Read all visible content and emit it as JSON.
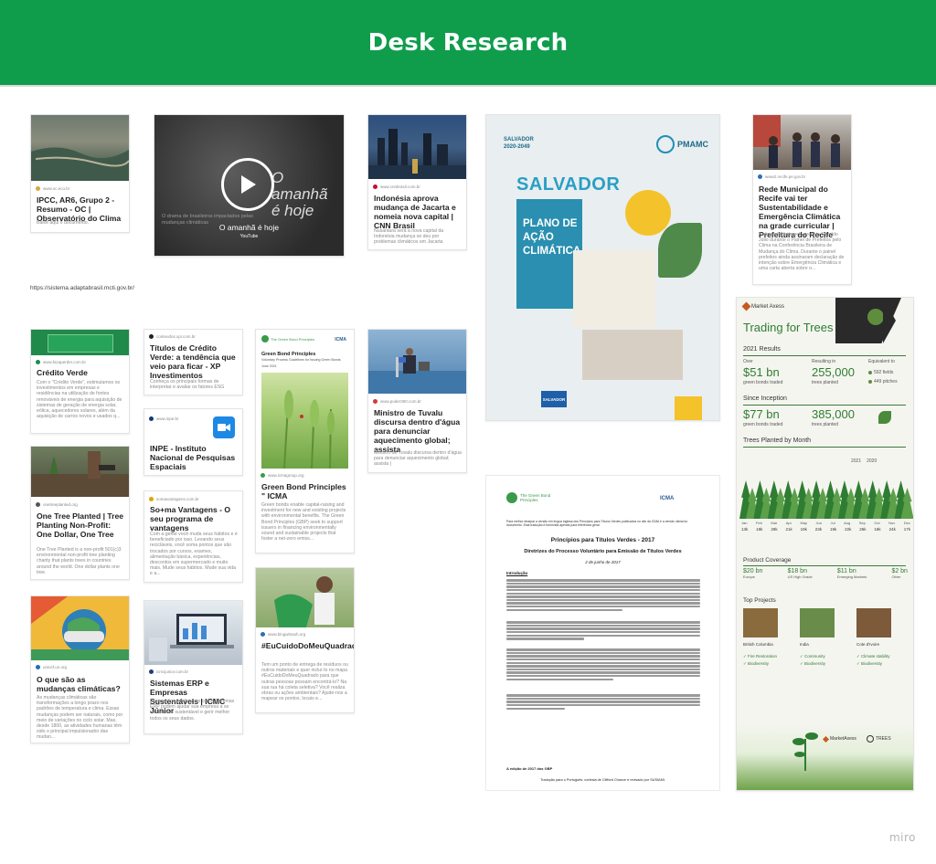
{
  "header": {
    "title": "Desk Research"
  },
  "footer": {
    "brand": "miro",
    "url_text": "https://sistema.adaptabrasil.mcti.gov.br/"
  },
  "cards": {
    "ipcc": {
      "source": "www.oc.eco.br",
      "title": "IPCC, AR6, Grupo 2 - Resumo - OC | Observatório do Clima",
      "desc": "Baixe aqui o documento."
    },
    "video": {
      "overlay": "O amanhã é hoje",
      "caption": "O amanhã é hoje",
      "platform": "YouTube",
      "subtitle": "O drama de brasileiros impactados pelas mudanças climáticas"
    },
    "indonesia": {
      "source": "www.cnnbrasil.com.br",
      "title": "Indonésia aprova mudança de Jacarta e nomeia nova capital | CNN Brasil",
      "desc": "Nusantara será a nova capital da Indonésia mudança se deu por problemas climáticos em Jacarta"
    },
    "salvador": {
      "top": "SALVADOR",
      "years": "2020-2049",
      "city": "SALVADOR",
      "plan": "PLANO DE AÇÃO CLIMÁTICA",
      "logo": "PMAMC",
      "bottom": "SALVADOR"
    },
    "recife": {
      "source": "www2.recife.pe.gov.br",
      "title": "Rede Municipal do Recife vai ter Sustentabilidade e Emergência Climática na grade curricular | Prefeitura do Recife",
      "desc": "Anúncio foi feito pelo prefeito Geraldo Júlio durante o Painel de Prefeitos pelo Clima na Conferência Brasileira de Mudança do Clima. Durante o painel prefeitos ainda assinaram declaração de intenção sobre Emergência Climática e uma carta aberta sobre o..."
    },
    "credito": {
      "source": "www.fazaperder.com.br",
      "title": "Crédito Verde",
      "desc": "Com o \"Crédito Verde\", estimulamos os investimentos em empresas e residências na utilização de fontes renováveis de energia para aquisição de sistemas de geração de energia solar, eólica, aquecedores solares, além da aquisição de carros novos e usados q..."
    },
    "titulos": {
      "source": "conteudos.xpi.com.br",
      "title": "Títulos de Crédito Verde: a tendência que veio para ficar - XP Investimentos",
      "desc": "Conheça os principais formas de interpretar e avaliar os fatores ESG"
    },
    "inpe": {
      "source": "www.inpe.br",
      "title": "INPE - Instituto Nacional de Pesquisas Espaciais"
    },
    "somavantagens": {
      "source": "somavantagens.com.br",
      "title": "So+ma Vantagens - O seu programa de vantagens",
      "desc": "Com a gente você muda seus hábitos e é beneficiado por isso. Levando seus recicláveis, você soma pontos que são trocados por cursos, exames, alimentação básica, experiências, descontos em supermercado e muito mais. Mude seus hábitos. Mude sua vida e a..."
    },
    "greenbond": {
      "source": "www.icmagroup.org",
      "title": "Green Bond Principles \" ICMA",
      "desc": "Green bonds enable capital-raising and investment for new and existing projects with environmental benefits. The Green Bond Principles (GBP) seek to support issuers in financing environmentally sound and sustainable projects that foster a net-zero emiss...",
      "doc_title": "Green Bond Principles",
      "doc_sub": "Voluntary Process Guidelines for Issuing Green Bonds",
      "doc_date": "June 2021",
      "brand": "ICMA"
    },
    "tuvalu": {
      "source": "www.poder360.com.br",
      "title": "Ministro de Tuvalu discursa dentro d'água para denunciar aquecimento global; assista",
      "desc": "Ministro de Tuvalu discursa dentro d'água para denunciar aquecimento global; assista |"
    },
    "onetree": {
      "source": "onetreeplanted.org",
      "title": "One Tree Planted | Tree Planting Non-Profit: One Dollar, One Tree",
      "desc": "One Tree Planted is a non-profit 501(c)3 environmental non-profit tree planting charity that plants trees in countries around the world. One dollar plants one tree."
    },
    "eucuido": {
      "source": "www.blogwitrash.org",
      "title": "#EuCuidoDoMeuQuadrado",
      "desc": "Tem um ponto de entrega de resíduos ou outros materiais e quer incluí-lo no mapa #EuCuidoDoMeuQuadrado para que outras pessoas possam encontrá-lo? Na sua rua há coleta seletiva? Você realiza obras ou ações ambientais? Ajude-nos a mapear os pontos, locais e..."
    },
    "mudancas": {
      "source": "unicef.un.org",
      "title": "O que são as mudanças climáticas?",
      "desc": "As mudanças climáticas são transformações a longo prazo nos padrões de temperatura e clima. Essas mudanças podem ser naturais, como por meio de variações no ciclo solar. Mas, desde 1800, as atividades humanas têm sido o principal impulsionador das mudan..."
    },
    "erp": {
      "source": "icmcjunior.com.br",
      "title": "Sistemas ERP e Empresas Sustentáveis | ICMC Júnior",
      "desc": "Neste artigo explicamos como Sistemas ERP podem ajudar sua empresa a se tornar mais sustentável e gerir melhor todos os seus dados."
    }
  },
  "gbp_doc": {
    "brand": "The Green Bond Principles",
    "icma": "ICMA",
    "intro_line": "Para melhor dissipar a versão em língua inglesa dos Princípios para Títulos Verdes publicados no site da ICMA é a versão oficial do documento. Esta tradução é fornecida apenas para referência geral.",
    "title": "Princípios para Títulos Verdes - 2017",
    "subtitle": "Diretrizes do Processo Voluntário para Emissão de Títulos Verdes",
    "date": "2 de junho de 2017",
    "section": "Introdução",
    "edition": "A edição de 2017 dos GBP",
    "translation": "Tradução para o Português: cortesia de Clifford Chance e revisado por SUSIAMI."
  },
  "infographic": {
    "brand": "Market Axess",
    "title": "Trading for Trees",
    "results_label": "2021 Results",
    "over_label": "Over",
    "over_value": "$51 bn",
    "over_sub": "green bonds traded",
    "result_label": "Resulting in",
    "result_value": "255,000",
    "result_sub": "trees planted",
    "equiv_label": "Equivalent to",
    "equiv_a": "592 fields",
    "equiv_b": "449 pitches",
    "since_label": "Since Inception",
    "since_value": "$77 bn",
    "since_sub": "green bonds traded",
    "since_trees": "385,000",
    "since_trees_sub": "trees planted",
    "month_label": "Trees Planted by Month",
    "legend_a": "2021",
    "legend_b": "2020",
    "months": [
      "Jan",
      "Feb",
      "Mar",
      "Apr",
      "May",
      "Jun",
      "Jul",
      "Aug",
      "Sep",
      "Oct",
      "Nov",
      "Dec"
    ],
    "month_values": [
      "13k",
      "18k",
      "28k",
      "21k",
      "19k",
      "23k",
      "19k",
      "22k",
      "26k",
      "18k",
      "24k",
      "17k"
    ],
    "coverage_label": "Product Coverage",
    "coverage": [
      {
        "value": "$20 bn",
        "label": "Europe"
      },
      {
        "value": "$18 bn",
        "label": "US High Grade"
      },
      {
        "value": "$11 bn",
        "label": "Emerging Markets"
      },
      {
        "value": "$2 bn",
        "label": "Other"
      }
    ],
    "projects_label": "Top Projects",
    "projects": [
      {
        "name": "British Columbia",
        "a": "Fire Restoration",
        "b": "Biodiversity"
      },
      {
        "name": "India",
        "a": "Community",
        "b": "Biodiversity"
      },
      {
        "name": "Cote d'Ivoire",
        "a": "Climate stability",
        "b": "Biodiversity"
      }
    ],
    "footer_a": "MarketAxess",
    "footer_b": "TREES"
  }
}
